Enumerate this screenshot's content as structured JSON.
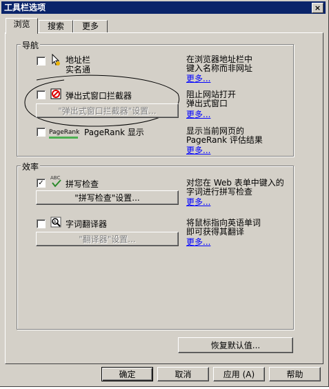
{
  "window": {
    "title": "工具栏选项",
    "close_glyph": "×"
  },
  "tabs": [
    {
      "label": "浏览",
      "active": true
    },
    {
      "label": "搜索",
      "active": false
    },
    {
      "label": "更多",
      "active": false
    }
  ],
  "nav_group": {
    "title": "导航",
    "items": [
      {
        "icon": "address-bar-icon",
        "label_line1": "地址栏",
        "label_line2": "实名通",
        "checked": false,
        "desc_line1": "在浏览器地址栏中",
        "desc_line2": "键入名称而非网址",
        "more": "更多..."
      },
      {
        "icon": "popup-blocker-icon",
        "label_line1": "弹出式窗口拦截器",
        "checked": false,
        "button": "\"弹出式窗口拦截器\"设置...",
        "button_disabled": true,
        "desc_line1": "阻止网站打开",
        "desc_line2": "弹出式窗口",
        "more": "更多..."
      },
      {
        "icon": "pagerank-icon",
        "icon_text": "PageRank",
        "label_line1": "PageRank 显示",
        "checked": false,
        "desc_line1": "显示当前网页的",
        "desc_line2": "PageRank 评估结果",
        "more": "更多..."
      }
    ]
  },
  "eff_group": {
    "title": "效率",
    "items": [
      {
        "icon": "spell-check-icon",
        "icon_text": "ABC",
        "label_line1": "拼写检查",
        "checked": true,
        "button": "\"拼写检查\"设置...",
        "button_disabled": false,
        "desc_line1": "对您在 Web 表单中键入的",
        "desc_line2": "字词进行拼写检查",
        "more": "更多..."
      },
      {
        "icon": "translator-icon",
        "label_line1": "字词翻译器",
        "checked": false,
        "button": "\"翻译器\"设置...",
        "button_disabled": true,
        "desc_line1": "将鼠标指向英语单词",
        "desc_line2": "即可获得其翻译",
        "more": "更多..."
      }
    ]
  },
  "restore_button": "恢复默认值...",
  "buttons": {
    "ok": "确定",
    "cancel": "取消",
    "apply": "应用 (A)",
    "help": "帮助"
  },
  "checkmark": "✓",
  "colors": {
    "title_bar": "#0a246a",
    "face": "#d4d0c8",
    "link": "#0000ff",
    "pagerank_bar": "#4caf50"
  }
}
